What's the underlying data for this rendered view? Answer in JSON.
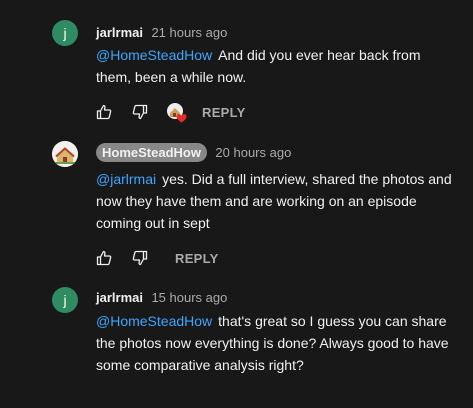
{
  "comments": [
    {
      "author": "jarlrmai",
      "avatar_letter": "j",
      "time": "21 hours ago",
      "mention": "@HomeSteadHow",
      "text": "And did you ever hear back from them, been a while now.",
      "reply_label": "REPLY"
    },
    {
      "author": "HomeSteadHow",
      "time": "20 hours ago",
      "mention": "@jarlrmai",
      "text": "yes. Did a full interview, shared the photos and now they have them and are working on an episode coming out in sept",
      "reply_label": "REPLY"
    },
    {
      "author": "jarlrmai",
      "avatar_letter": "j",
      "time": "15 hours ago",
      "mention": "@HomeSteadHow",
      "text": "that's great so I guess you can share the photos now everything is done? Always good to have some comparative analysis right?"
    }
  ],
  "colors": {
    "mention": "#3ea6ff",
    "avatar_green": "#2e8b62",
    "heart": "#e52d27"
  },
  "icons": [
    "like-icon",
    "dislike-icon",
    "creator-heart-icon"
  ]
}
